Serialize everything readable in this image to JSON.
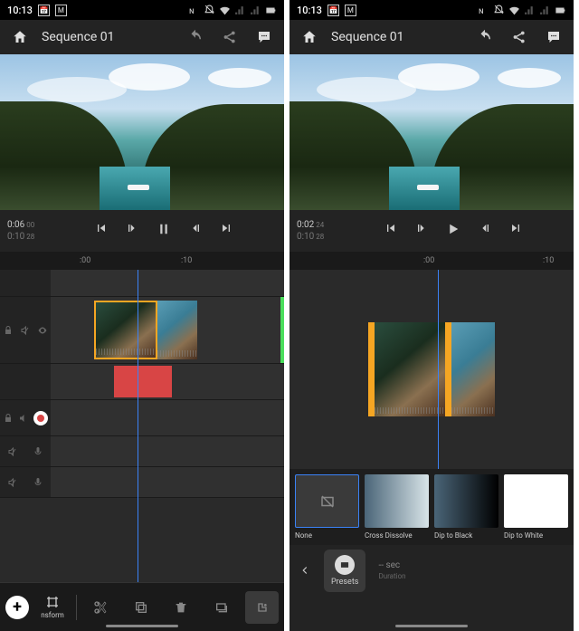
{
  "left": {
    "status": {
      "time": "10:13"
    },
    "project_title": "Sequence 01",
    "current_time": "0:06",
    "current_frames": "00",
    "total_time": "0:10",
    "total_frames": "28",
    "ruler": {
      "t0": ":00",
      "t10": ":10"
    },
    "bottom_tab_label": "nsform"
  },
  "right": {
    "status": {
      "time": "10:13"
    },
    "project_title": "Sequence 01",
    "current_time": "0:02",
    "current_frames": "24",
    "total_time": "0:10",
    "total_frames": "28",
    "ruler": {
      "t0": ":00",
      "t10": ":10"
    },
    "transitions": [
      {
        "label": "None"
      },
      {
        "label": "Cross Dissolve"
      },
      {
        "label": "Dip to Black"
      },
      {
        "label": "Dip to White"
      }
    ],
    "presets_label": "Presets",
    "duration_value": "-- sec",
    "duration_label": "Duration"
  }
}
